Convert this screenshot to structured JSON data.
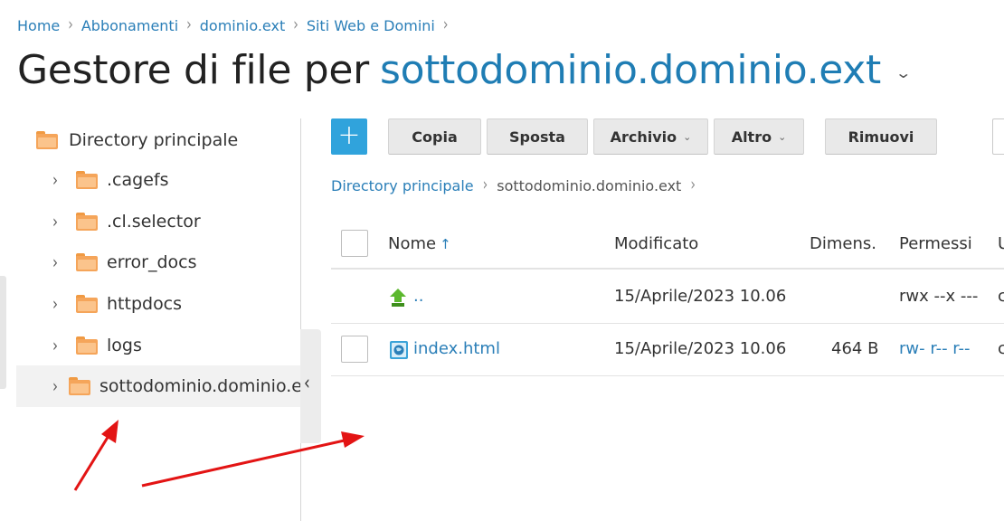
{
  "breadcrumb": [
    "Home",
    "Abbonamenti",
    "dominio.ext",
    "Siti Web e Domini"
  ],
  "title": {
    "prefix": "Gestore di file per",
    "domain": "sottodominio.dominio.ext"
  },
  "tree": {
    "root": "Directory principale",
    "items": [
      {
        "label": ".cagefs"
      },
      {
        "label": ".cl.selector"
      },
      {
        "label": "error_docs"
      },
      {
        "label": "httpdocs"
      },
      {
        "label": "logs"
      },
      {
        "label": "sottodominio.dominio.ext",
        "selected": true
      }
    ]
  },
  "toolbar": {
    "add_label": "+",
    "copy_label": "Copia",
    "move_label": "Sposta",
    "archive_label": "Archivio",
    "more_label": "Altro",
    "remove_label": "Rimuovi"
  },
  "path": {
    "root": "Directory principale",
    "current": "sottodominio.dominio.ext"
  },
  "table": {
    "columns": {
      "name": "Nome",
      "name_sort": "↑",
      "modified": "Modificato",
      "size": "Dimens.",
      "permissions": "Permessi",
      "user": "U"
    },
    "rows": [
      {
        "name": "..",
        "icon": "parent-folder-up-icon",
        "modified": "15/Aprile/2023 10.06",
        "size": "",
        "permissions": "rwx --x ---",
        "user": "c"
      },
      {
        "name": "index.html",
        "icon": "html-file-icon",
        "modified": "15/Aprile/2023 10.06",
        "size": "464 B",
        "permissions": "rw- r-- r--",
        "user": "c"
      }
    ]
  },
  "colors": {
    "link": "#2b7fb8",
    "accent": "#30a3dc",
    "folder": "#f5a55a",
    "annotation_arrow": "#e31414"
  }
}
